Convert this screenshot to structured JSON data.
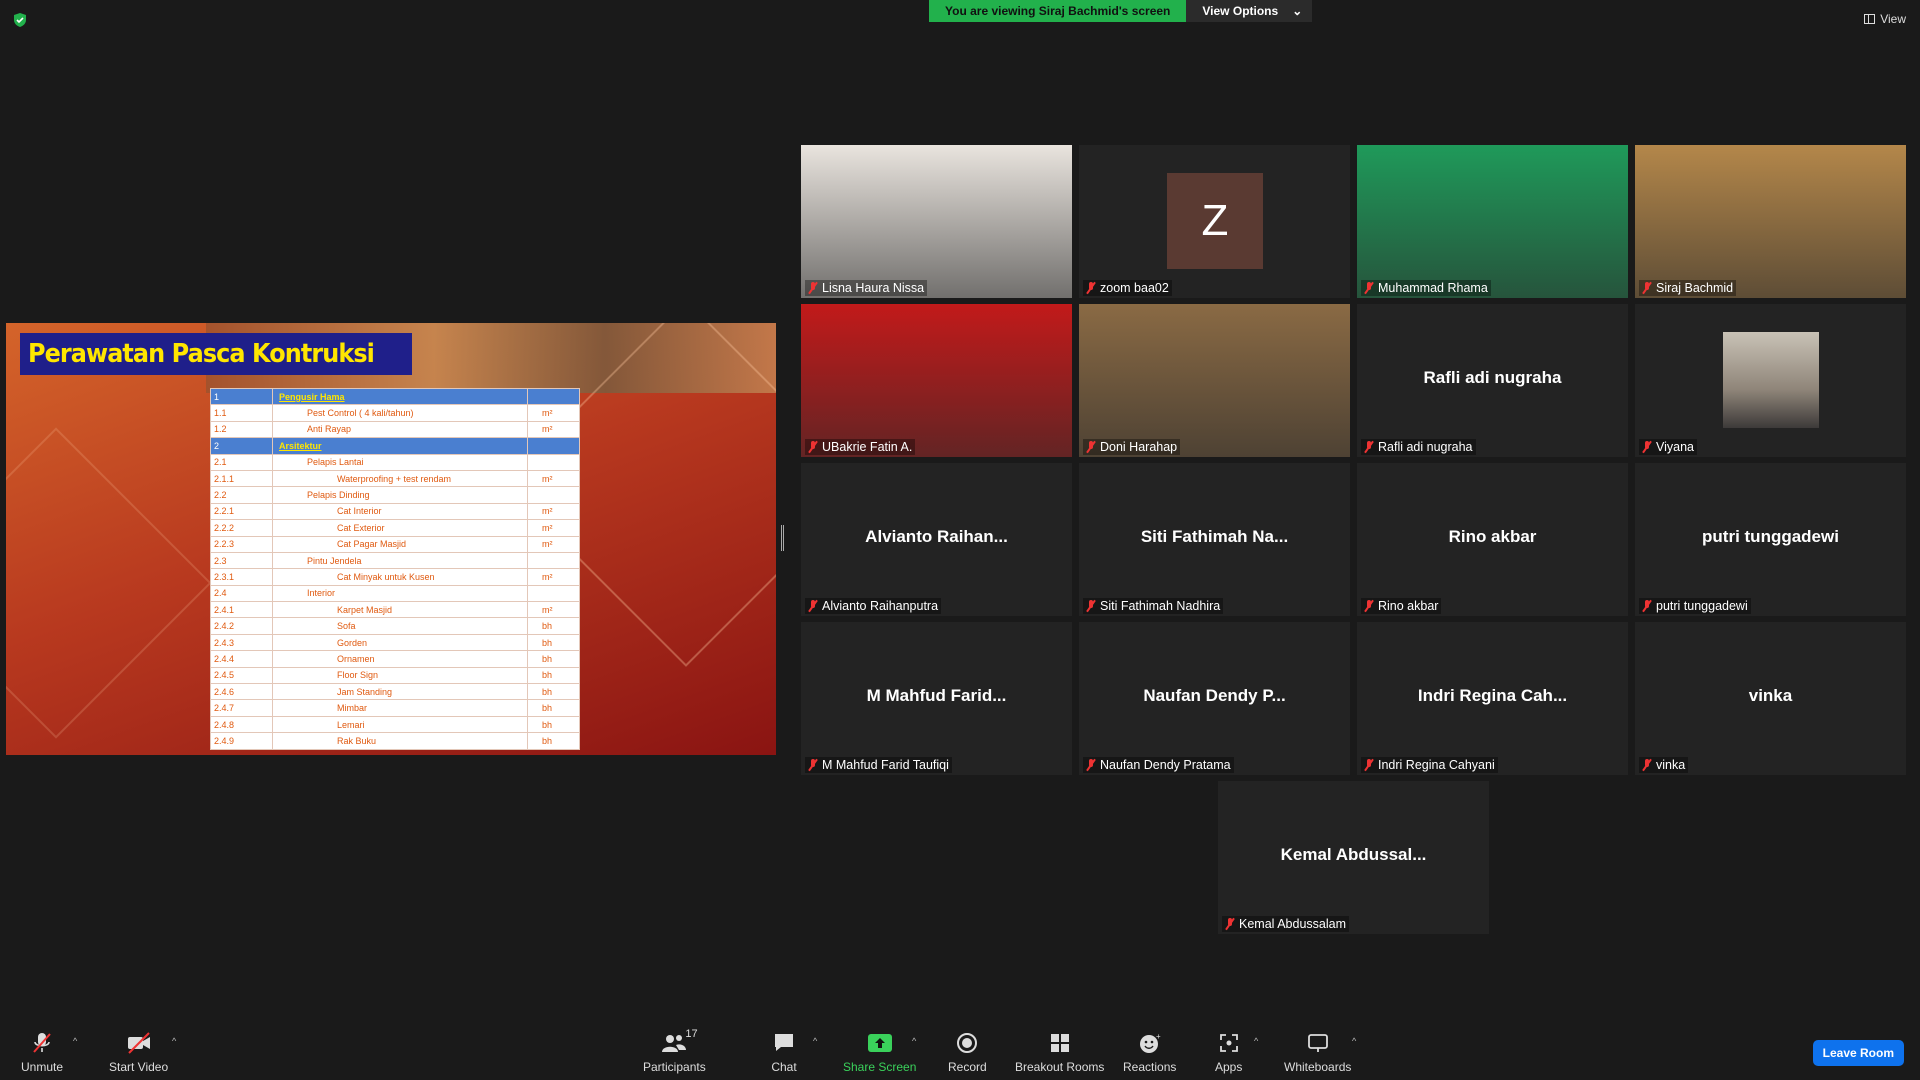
{
  "banner": {
    "viewing_text": "You are viewing Siraj Bachmid's screen",
    "view_options": "View Options",
    "view_label": "View"
  },
  "slide": {
    "title": "Perawatan Pasca Kontruksi",
    "rows": [
      {
        "no": "1",
        "item": "Pengusir Hama",
        "unit": "",
        "level": 1,
        "head": true
      },
      {
        "no": "1.1",
        "item": "Pest Control ( 4 kali/tahun)",
        "unit": "m²",
        "level": 2
      },
      {
        "no": "1.2",
        "item": "Anti Rayap",
        "unit": "m²",
        "level": 2
      },
      {
        "no": "2",
        "item": "Arsitektur",
        "unit": "",
        "level": 1,
        "head": true
      },
      {
        "no": "2.1",
        "item": "Pelapis Lantai",
        "unit": "",
        "level": 2
      },
      {
        "no": "2.1.1",
        "item": "Waterproofing + test rendam",
        "unit": "m²",
        "level": 3
      },
      {
        "no": "2.2",
        "item": "Pelapis Dinding",
        "unit": "",
        "level": 2
      },
      {
        "no": "2.2.1",
        "item": "Cat Interior",
        "unit": "m²",
        "level": 3
      },
      {
        "no": "2.2.2",
        "item": "Cat Exterior",
        "unit": "m²",
        "level": 3
      },
      {
        "no": "2.2.3",
        "item": "Cat Pagar Masjid",
        "unit": "m²",
        "level": 3
      },
      {
        "no": "2.3",
        "item": "Pintu Jendela",
        "unit": "",
        "level": 2
      },
      {
        "no": "2.3.1",
        "item": "Cat Minyak untuk Kusen",
        "unit": "m²",
        "level": 3
      },
      {
        "no": "2.4",
        "item": "Interior",
        "unit": "",
        "level": 2
      },
      {
        "no": "2.4.1",
        "item": "Karpet Masjid",
        "unit": "m²",
        "level": 3
      },
      {
        "no": "2.4.2",
        "item": "Sofa",
        "unit": "bh",
        "level": 3
      },
      {
        "no": "2.4.3",
        "item": "Gorden",
        "unit": "bh",
        "level": 3
      },
      {
        "no": "2.4.4",
        "item": "Ornamen",
        "unit": "bh",
        "level": 3
      },
      {
        "no": "2.4.5",
        "item": "Floor Sign",
        "unit": "bh",
        "level": 3
      },
      {
        "no": "2.4.6",
        "item": "Jam Standing",
        "unit": "bh",
        "level": 3
      },
      {
        "no": "2.4.7",
        "item": "Mimbar",
        "unit": "bh",
        "level": 3
      },
      {
        "no": "2.4.8",
        "item": "Lemari",
        "unit": "bh",
        "level": 3
      },
      {
        "no": "2.4.9",
        "item": "Rak Buku",
        "unit": "bh",
        "level": 3
      }
    ]
  },
  "participants": [
    {
      "label": "Lisna Haura Nissa",
      "big": "",
      "kind": "video",
      "bg": "#e9e4de"
    },
    {
      "label": "zoom baa02",
      "big": "",
      "kind": "avatar-z",
      "initial": "Z"
    },
    {
      "label": "Muhammad Rhama",
      "big": "",
      "kind": "video",
      "bg": "#1f9a5a"
    },
    {
      "label": "Siraj Bachmid",
      "big": "",
      "kind": "video",
      "bg": "#b4874a",
      "active": true
    },
    {
      "label": "UBakrie Fatin A.",
      "big": "",
      "kind": "video",
      "bg": "#c21a1a"
    },
    {
      "label": "Doni Harahap",
      "big": "",
      "kind": "video",
      "bg": "#8a6a44"
    },
    {
      "label": "Rafli adi nugraha",
      "big": "Rafli adi nugraha",
      "kind": "name"
    },
    {
      "label": "Viyana",
      "big": "",
      "kind": "avatar-photo"
    },
    {
      "label": "Alvianto Raihanputra",
      "big": "Alvianto  Raihan...",
      "kind": "name"
    },
    {
      "label": "Siti Fathimah Nadhira",
      "big": "Siti  Fathimah  Na...",
      "kind": "name"
    },
    {
      "label": "Rino akbar",
      "big": "Rino akbar",
      "kind": "name"
    },
    {
      "label": "putri tunggadewi",
      "big": "putri tunggadewi",
      "kind": "name"
    },
    {
      "label": "M Mahfud Farid Taufiqi",
      "big": "M  Mahfud  Farid...",
      "kind": "name"
    },
    {
      "label": "Naufan Dendy Pratama",
      "big": "Naufan  Dendy  P...",
      "kind": "name"
    },
    {
      "label": "Indri Regina Cahyani",
      "big": "Indri  Regina  Cah...",
      "kind": "name"
    },
    {
      "label": "vinka",
      "big": "vinka",
      "kind": "name"
    },
    {
      "label": "Kemal Abdussalam",
      "big": "Kemal  Abdussal...",
      "kind": "name"
    }
  ],
  "toolbar": {
    "unmute": "Unmute",
    "start_video": "Start Video",
    "participants": "Participants",
    "participant_count": "17",
    "chat": "Chat",
    "share_screen": "Share Screen",
    "record": "Record",
    "breakout_rooms": "Breakout Rooms",
    "reactions": "Reactions",
    "apps": "Apps",
    "whiteboards": "Whiteboards",
    "leave": "Leave Room"
  },
  "colors": {
    "share_green": "#22b14c",
    "active_speaker": "#e8e24a",
    "leave_blue": "#0e72ed",
    "muted_red": "#e33333"
  }
}
